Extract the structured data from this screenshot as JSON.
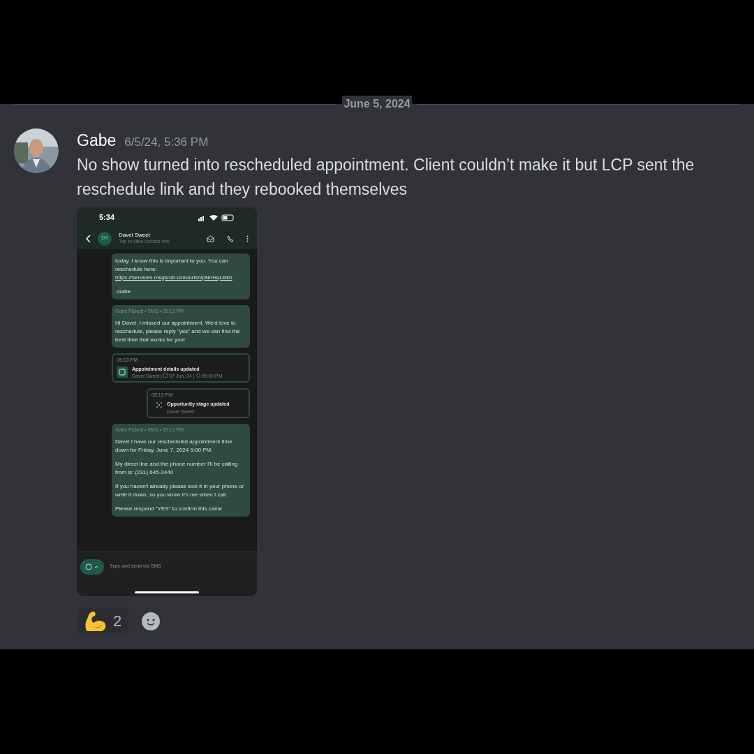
{
  "date_divider": "June 5, 2024",
  "message": {
    "author": "Gabe",
    "timestamp": "6/5/24, 5:36 PM",
    "text": "No show turned into rescheduled appointment. Client couldn’t make it but LCP sent the reschedule link and they rebooked themselves",
    "attachment": {
      "status_time": "5:34",
      "contact": {
        "initials": "DS",
        "name": "Davel Sweet",
        "subtitle": "Tap to view contact info"
      },
      "items": [
        {
          "kind": "sms",
          "lines": [
            "today. I know this is important to you. You can reschedule here: "
          ],
          "link": "https://services.msgsndr.com/urls/l/pNnHqLBkh",
          "signature": "-Gabe"
        },
        {
          "kind": "sms",
          "meta": "Gabe Pickett • SMS • 05:13 PM",
          "lines": [
            "Hi Davel. I missed our appointment. We'd love to reschedule, please reply \"yes\" and we can find the best time that works for you!"
          ]
        },
        {
          "kind": "event",
          "time": "05:13 PM",
          "title": "Appointment details updated",
          "contact": "Davel Sweet |",
          "date": "07 Jun, 24 |",
          "at": "05:00 PM"
        },
        {
          "kind": "stage",
          "time": "05:13 PM",
          "title": "Opportunity stage updated",
          "contact": "Davel Sweet"
        },
        {
          "kind": "sms",
          "meta": "Gabe Pickett • SMS • 05:13 PM",
          "lines": [
            "Davel I have our rescheduled appointment time down for Friday, June 7, 2024 5:00 PM.",
            "My direct line and the phone number I'll be calling from is: (231) 645-2440",
            "If you haven't already please lock it in your phone or write it down, so you know it's me when I call.",
            "Please respond \"YES\" to confirm this came"
          ]
        }
      ],
      "composer_placeholder": "Type and send via SMS"
    },
    "reactions": [
      {
        "kind": "emoji",
        "count": "2",
        "selected": false
      },
      {
        "kind": "add"
      }
    ]
  }
}
